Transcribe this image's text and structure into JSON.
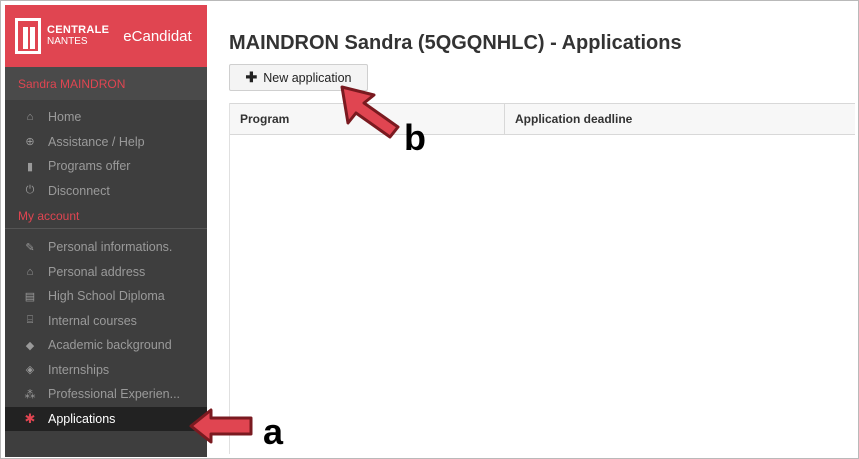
{
  "brand": {
    "logo_line1": "CENTRALE",
    "logo_line2": "NANTES",
    "app_name": "eCandidat",
    "accent_color": "#e04551"
  },
  "sidebar": {
    "user_name": "Sandra MAINDRON",
    "items": [
      {
        "label": "Home",
        "icon": "home-icon"
      },
      {
        "label": "Assistance / Help",
        "icon": "lifebuoy-icon"
      },
      {
        "label": "Programs offer",
        "icon": "bookmark-icon"
      },
      {
        "label": "Disconnect",
        "icon": "power-icon"
      }
    ],
    "section_label": "My account",
    "account_items": [
      {
        "label": "Personal informations.",
        "icon": "pencil-icon"
      },
      {
        "label": "Personal address",
        "icon": "home-icon"
      },
      {
        "label": "High School Diploma",
        "icon": "book-icon"
      },
      {
        "label": "Internal courses",
        "icon": "institution-icon"
      },
      {
        "label": "Academic background",
        "icon": "graduation-cap-icon"
      },
      {
        "label": "Internships",
        "icon": "cube-icon"
      },
      {
        "label": "Professional Experien...",
        "icon": "cubes-icon"
      },
      {
        "label": "Applications",
        "icon": "asterisk-icon",
        "active": true
      }
    ]
  },
  "main": {
    "title": "MAINDRON Sandra (5QGQNHLC) - Applications",
    "new_button_label": "New application",
    "columns": [
      "Program",
      "Application deadline"
    ]
  },
  "annotations": {
    "a": "a",
    "b": "b"
  }
}
